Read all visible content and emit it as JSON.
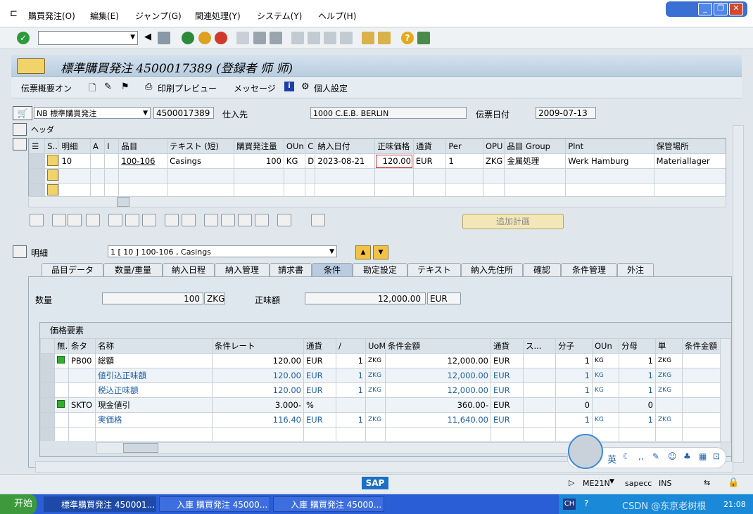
{
  "menu": [
    "購買発注(O)",
    "編集(E)",
    "ジャンプ(G)",
    "関連処理(Y)",
    "システム(Y)",
    "ヘルプ(H)"
  ],
  "title": "標準購買発注 4500017389 (登録者 师 师)",
  "app_toolbar": {
    "overview": "伝票概要オン",
    "print_preview": "印刷プレビュー",
    "messages": "メッセージ",
    "personal": "個人設定"
  },
  "header": {
    "doc_type": "NB 標準購買発注",
    "po_number": "4500017389",
    "vendor_label": "仕入先",
    "vendor_value": "1000 C.E.B. BERLIN",
    "date_label": "伝票日付",
    "date_value": "2009-07-13",
    "header_label": "ヘッダ"
  },
  "items_table": {
    "columns": [
      "S..",
      "明細",
      "A",
      "I",
      "品目",
      "テキスト (短)",
      "購買発注量",
      "OUn",
      "C",
      "納入日付",
      "正味価格",
      "通貨",
      "Per",
      "OPU",
      "品目 Group",
      "Plnt",
      "保管場所"
    ],
    "rows": [
      {
        "item": "10",
        "material": "100-106",
        "text": "Casings",
        "qty": "100",
        "oun": "KG",
        "c": "D",
        "date": "2023-08-21",
        "price": "120.00",
        "curr": "EUR",
        "per": "1",
        "opu": "ZKG",
        "group": "金属処理",
        "plant": "Werk Hamburg",
        "sloc": "Materiallager"
      }
    ]
  },
  "add_planning": "追加計画",
  "detail": {
    "label": "明細",
    "selector": "1 [ 10 ] 100-106 , Casings",
    "tabs": [
      "品目データ",
      "数量/重量",
      "納入日程",
      "納入管理",
      "請求書",
      "条件",
      "勘定設定",
      "テキスト",
      "納入先住所",
      "確認",
      "条件管理",
      "外注"
    ],
    "active_tab": "条件",
    "qty_label": "数量",
    "qty_value": "100",
    "qty_unit": "ZKG",
    "net_label": "正味額",
    "net_value": "12,000.00",
    "net_curr": "EUR"
  },
  "pricing": {
    "title": "価格要素",
    "columns": [
      "無.",
      "条タ",
      "名称",
      "条件レート",
      "通貨",
      "/",
      "UoM",
      "条件金額",
      "通貨",
      "ス...",
      "分子",
      "OUn",
      "分母",
      "単",
      "条件金額"
    ],
    "rows": [
      {
        "status": "green",
        "type": "PB00",
        "name": "総額",
        "rate": "120.00",
        "curr": "EUR",
        "per": "1",
        "uom": "ZKG",
        "value": "12,000.00",
        "vcurr": "EUR",
        "num": "1",
        "oun": "KG",
        "den": "1",
        "unit": "ZKG",
        "blue": false
      },
      {
        "status": "",
        "type": "",
        "name": "値引込正味額",
        "rate": "120.00",
        "curr": "EUR",
        "per": "1",
        "uom": "ZKG",
        "value": "12,000.00",
        "vcurr": "EUR",
        "num": "1",
        "oun": "KG",
        "den": "1",
        "unit": "ZKG",
        "blue": true
      },
      {
        "status": "",
        "type": "",
        "name": "税込正味額",
        "rate": "120.00",
        "curr": "EUR",
        "per": "1",
        "uom": "ZKG",
        "value": "12,000.00",
        "vcurr": "EUR",
        "num": "1",
        "oun": "KG",
        "den": "1",
        "unit": "ZKG",
        "blue": true
      },
      {
        "status": "green",
        "type": "SKTO",
        "name": "現金値引",
        "rate": "3.000-",
        "curr": "%",
        "per": "",
        "uom": "",
        "value": "360.00-",
        "vcurr": "EUR",
        "num": "0",
        "oun": "",
        "den": "0",
        "unit": "",
        "blue": false
      },
      {
        "status": "",
        "type": "",
        "name": "実価格",
        "rate": "116.40",
        "curr": "EUR",
        "per": "1",
        "uom": "ZKG",
        "value": "11,640.00",
        "vcurr": "EUR",
        "num": "1",
        "oun": "KG",
        "den": "1",
        "unit": "ZKG",
        "blue": true
      }
    ]
  },
  "status": {
    "tcode": "ME21N",
    "server": "sapecc",
    "mode": "INS",
    "sap_logo": "SAP"
  },
  "ime": {
    "lang": "英"
  },
  "taskbar": {
    "start": "开始",
    "tasks": [
      "標準購買発注 450001...",
      "入庫 購買発注 45000...",
      "入庫 購買発注 45000..."
    ],
    "lang": "CH",
    "clock": "21:08",
    "watermark": "CSDN @东京老树根"
  },
  "colors": {
    "accent": "#1f5fa8",
    "green_status": "#2fae2f",
    "taskbar": "#2a5ed6"
  }
}
